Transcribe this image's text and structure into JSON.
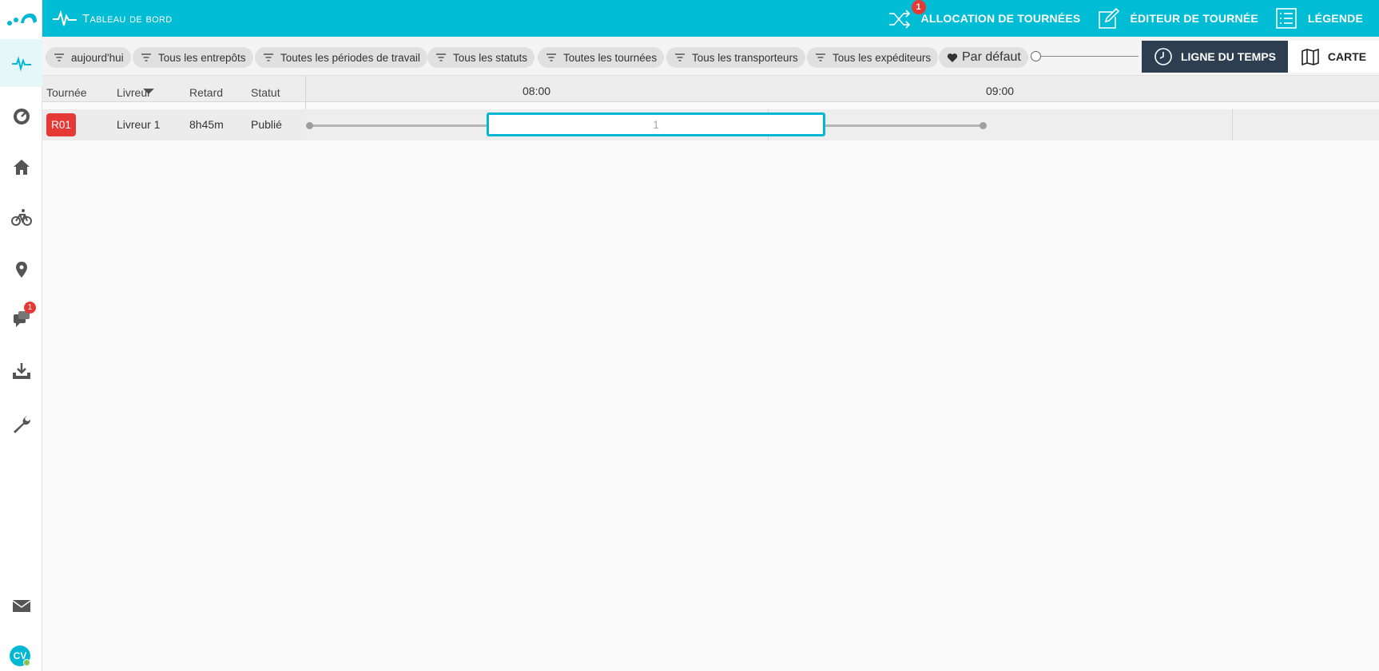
{
  "header": {
    "title": "Tableau de bord",
    "actions": [
      {
        "label": "ALLOCATION DE TOURNÉES",
        "icon": "shuffle-icon",
        "badge": "1"
      },
      {
        "label": "ÉDITEUR DE TOURNÉE",
        "icon": "edit-icon"
      },
      {
        "label": "LÉGENDE",
        "icon": "list-icon"
      }
    ]
  },
  "sidebar": {
    "items": [
      {
        "name": "dashboard",
        "icon": "pulse-icon",
        "active": true
      },
      {
        "name": "speed",
        "icon": "gauge-icon"
      },
      {
        "name": "depots",
        "icon": "home-icon"
      },
      {
        "name": "riders",
        "icon": "bicycle-icon"
      },
      {
        "name": "locations",
        "icon": "pin-icon"
      },
      {
        "name": "messages",
        "icon": "chat-icon",
        "badge": "1"
      },
      {
        "name": "import",
        "icon": "download-tray-icon"
      },
      {
        "name": "settings",
        "icon": "wrench-icon"
      },
      {
        "name": "mail",
        "icon": "mail-icon"
      }
    ],
    "avatar": "CV"
  },
  "filters": [
    {
      "label": "aujourd'hui"
    },
    {
      "label": "Tous les entrepôts"
    },
    {
      "label": "Toutes les périodes de travail"
    },
    {
      "label": "Tous les statuts"
    },
    {
      "label": "Toutes les tournées"
    },
    {
      "label": "Tous les transporteurs"
    },
    {
      "label": "Tous les expéditeurs"
    }
  ],
  "favorite_filter": "Par défaut",
  "views": {
    "timeline": "LIGNE DU TEMPS",
    "map": "CARTE",
    "active": "timeline"
  },
  "table": {
    "columns": [
      "Tournée",
      "Livreur",
      "Retard",
      "Statut"
    ],
    "times": [
      "08:00",
      "09:00"
    ],
    "rows": [
      {
        "route": "R01",
        "driver": "Livreur 1",
        "delay": "8h45m",
        "status": "Publié",
        "stop_label": "1"
      }
    ]
  },
  "colors": {
    "accent": "#00bcd4",
    "route_badge": "#e53935",
    "active_view": "#2c3e50"
  }
}
